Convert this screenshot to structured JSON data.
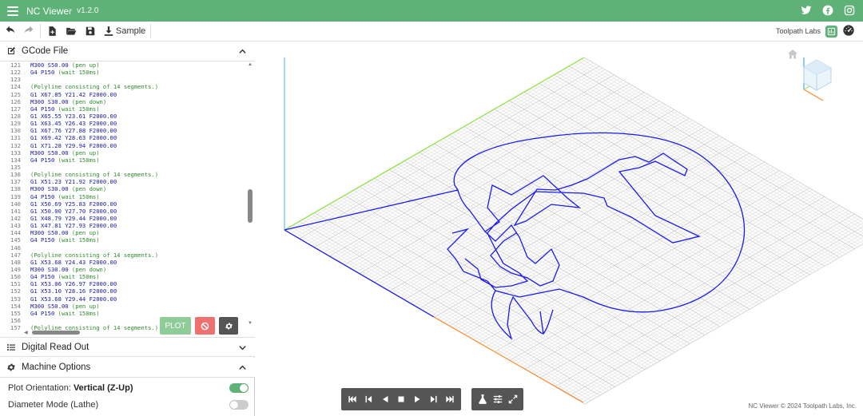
{
  "app": {
    "title": "NC Viewer",
    "version": "v1.2.0"
  },
  "toolbar": {
    "sample_label": "Sample",
    "brand_label": "Toolpath Labs"
  },
  "gcode_panel": {
    "title": "GCode File"
  },
  "code_lines": [
    {
      "n": "121",
      "c": "M300 S50.00",
      "cm": "(pen up)"
    },
    {
      "n": "122",
      "c": "G4 P150",
      "cm": "(wait 150ms)"
    },
    {
      "n": "123",
      "c": "",
      "cm": ""
    },
    {
      "n": "124",
      "c": "",
      "cm": "(Polyline consisting of 14 segments.)"
    },
    {
      "n": "125",
      "c": "G1 X67.85 Y21.42 F2000.00",
      "cm": ""
    },
    {
      "n": "126",
      "c": "M300 S30.00",
      "cm": "(pen down)"
    },
    {
      "n": "127",
      "c": "G4 P150",
      "cm": "(wait 150ms)"
    },
    {
      "n": "128",
      "c": "G1 X65.55 Y23.61 F2000.00",
      "cm": ""
    },
    {
      "n": "129",
      "c": "G1 X63.45 Y26.43 F2000.00",
      "cm": ""
    },
    {
      "n": "130",
      "c": "G1 X67.76 Y27.88 F2000.00",
      "cm": ""
    },
    {
      "n": "131",
      "c": "G1 X69.42 Y28.63 F2000.00",
      "cm": ""
    },
    {
      "n": "132",
      "c": "G1 X71.28 Y29.94 F2000.00",
      "cm": ""
    },
    {
      "n": "133",
      "c": "M300 S50.00",
      "cm": "(pen up)"
    },
    {
      "n": "134",
      "c": "G4 P150",
      "cm": "(wait 150ms)"
    },
    {
      "n": "135",
      "c": "",
      "cm": ""
    },
    {
      "n": "136",
      "c": "",
      "cm": "(Polyline consisting of 14 segments.)"
    },
    {
      "n": "137",
      "c": "G1 X51.23 Y21.92 F2000.00",
      "cm": ""
    },
    {
      "n": "138",
      "c": "M300 S30.00",
      "cm": "(pen down)"
    },
    {
      "n": "139",
      "c": "G4 P150",
      "cm": "(wait 150ms)"
    },
    {
      "n": "140",
      "c": "G1 X50.69 Y25.83 F2000.00",
      "cm": ""
    },
    {
      "n": "141",
      "c": "G1 X50.00 Y27.70 F2000.00",
      "cm": ""
    },
    {
      "n": "142",
      "c": "G1 X48.79 Y29.44 F2000.00",
      "cm": ""
    },
    {
      "n": "143",
      "c": "G1 X47.81 Y27.93 F2000.00",
      "cm": ""
    },
    {
      "n": "144",
      "c": "M300 S50.00",
      "cm": "(pen up)"
    },
    {
      "n": "145",
      "c": "G4 P150",
      "cm": "(wait 150ms)"
    },
    {
      "n": "146",
      "c": "",
      "cm": ""
    },
    {
      "n": "147",
      "c": "",
      "cm": "(Polyline consisting of 14 segments.)"
    },
    {
      "n": "148",
      "c": "G1 X53.68 Y24.43 F2000.00",
      "cm": ""
    },
    {
      "n": "149",
      "c": "M300 S30.00",
      "cm": "(pen down)"
    },
    {
      "n": "150",
      "c": "G4 P150",
      "cm": "(wait 150ms)"
    },
    {
      "n": "151",
      "c": "G1 X53.06 Y26.97 F2000.00",
      "cm": ""
    },
    {
      "n": "152",
      "c": "G1 X53.10 Y28.16 F2000.00",
      "cm": ""
    },
    {
      "n": "153",
      "c": "G1 X53.68 Y29.44 F2000.00",
      "cm": ""
    },
    {
      "n": "154",
      "c": "M300 S50.00",
      "cm": "(pen up)"
    },
    {
      "n": "155",
      "c": "G4 P150",
      "cm": "(wait 150ms)"
    },
    {
      "n": "156",
      "c": "",
      "cm": ""
    },
    {
      "n": "157",
      "c": "",
      "cm": "(Polyline consisting of 14 segments.)"
    }
  ],
  "actions": {
    "plot_label": "PLOT"
  },
  "dro_panel": {
    "title": "Digital Read Out"
  },
  "machine_panel": {
    "title": "Machine Options"
  },
  "options": {
    "plot_orientation_label": "Plot Orientation:",
    "plot_orientation_value": "Vertical (Z-Up)",
    "plot_orientation_on": true,
    "diameter_mode_label": "Diameter Mode (Lathe)",
    "diameter_mode_on": false
  },
  "viewport": {
    "copyright": "NC Viewer © 2024 Toolpath Labs, Inc."
  },
  "colors": {
    "accent": "#5eb277",
    "path": "#1a1aee",
    "x_axis": "#ff8a2a",
    "y_axis": "#88e23a",
    "z_axis": "#4aa8ff"
  }
}
